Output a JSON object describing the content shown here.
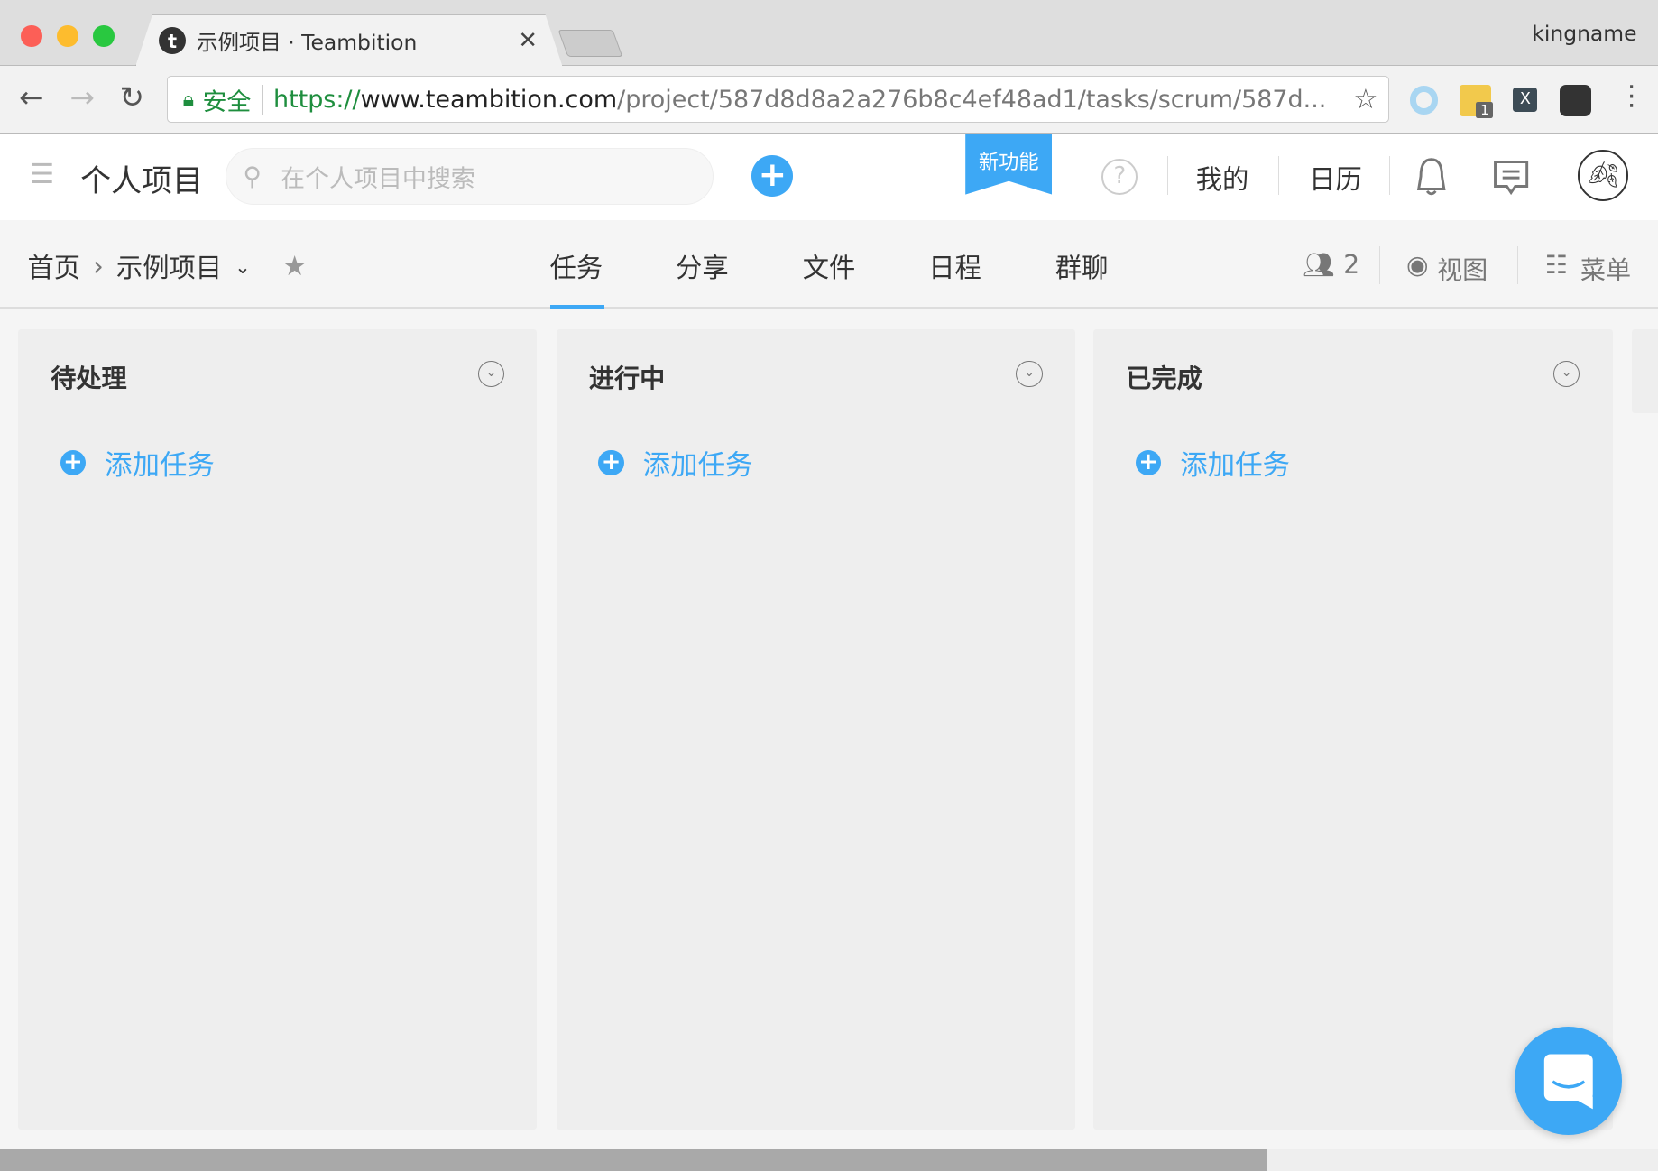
{
  "browser": {
    "tab_title": "示例项目 · Teambition",
    "profile": "kingname",
    "secure_label": "安全",
    "url_scheme": "https://",
    "url_host": "www.teambition.com",
    "url_path": "/project/587d8d8a2a276b8c4ef48ad1/tasks/scrum/587d...",
    "extension_badge": "1"
  },
  "header": {
    "project_title": "个人项目",
    "search_placeholder": "在个人项目中搜索",
    "new_feature": "新功能",
    "mine": "我的",
    "calendar": "日历"
  },
  "subnav": {
    "breadcrumb_home": "首页",
    "breadcrumb_project": "示例项目",
    "tabs": [
      "任务",
      "分享",
      "文件",
      "日程",
      "群聊"
    ],
    "active_tab": "任务",
    "members_count": "2",
    "view_label": "视图",
    "menu_label": "菜单"
  },
  "columns": [
    {
      "title": "待处理",
      "add_label": "添加任务"
    },
    {
      "title": "进行中",
      "add_label": "添加任务"
    },
    {
      "title": "已完成",
      "add_label": "添加任务"
    }
  ],
  "colors": {
    "accent": "#3da8f5"
  },
  "scrollbar": {
    "position_fraction": 0.76
  }
}
